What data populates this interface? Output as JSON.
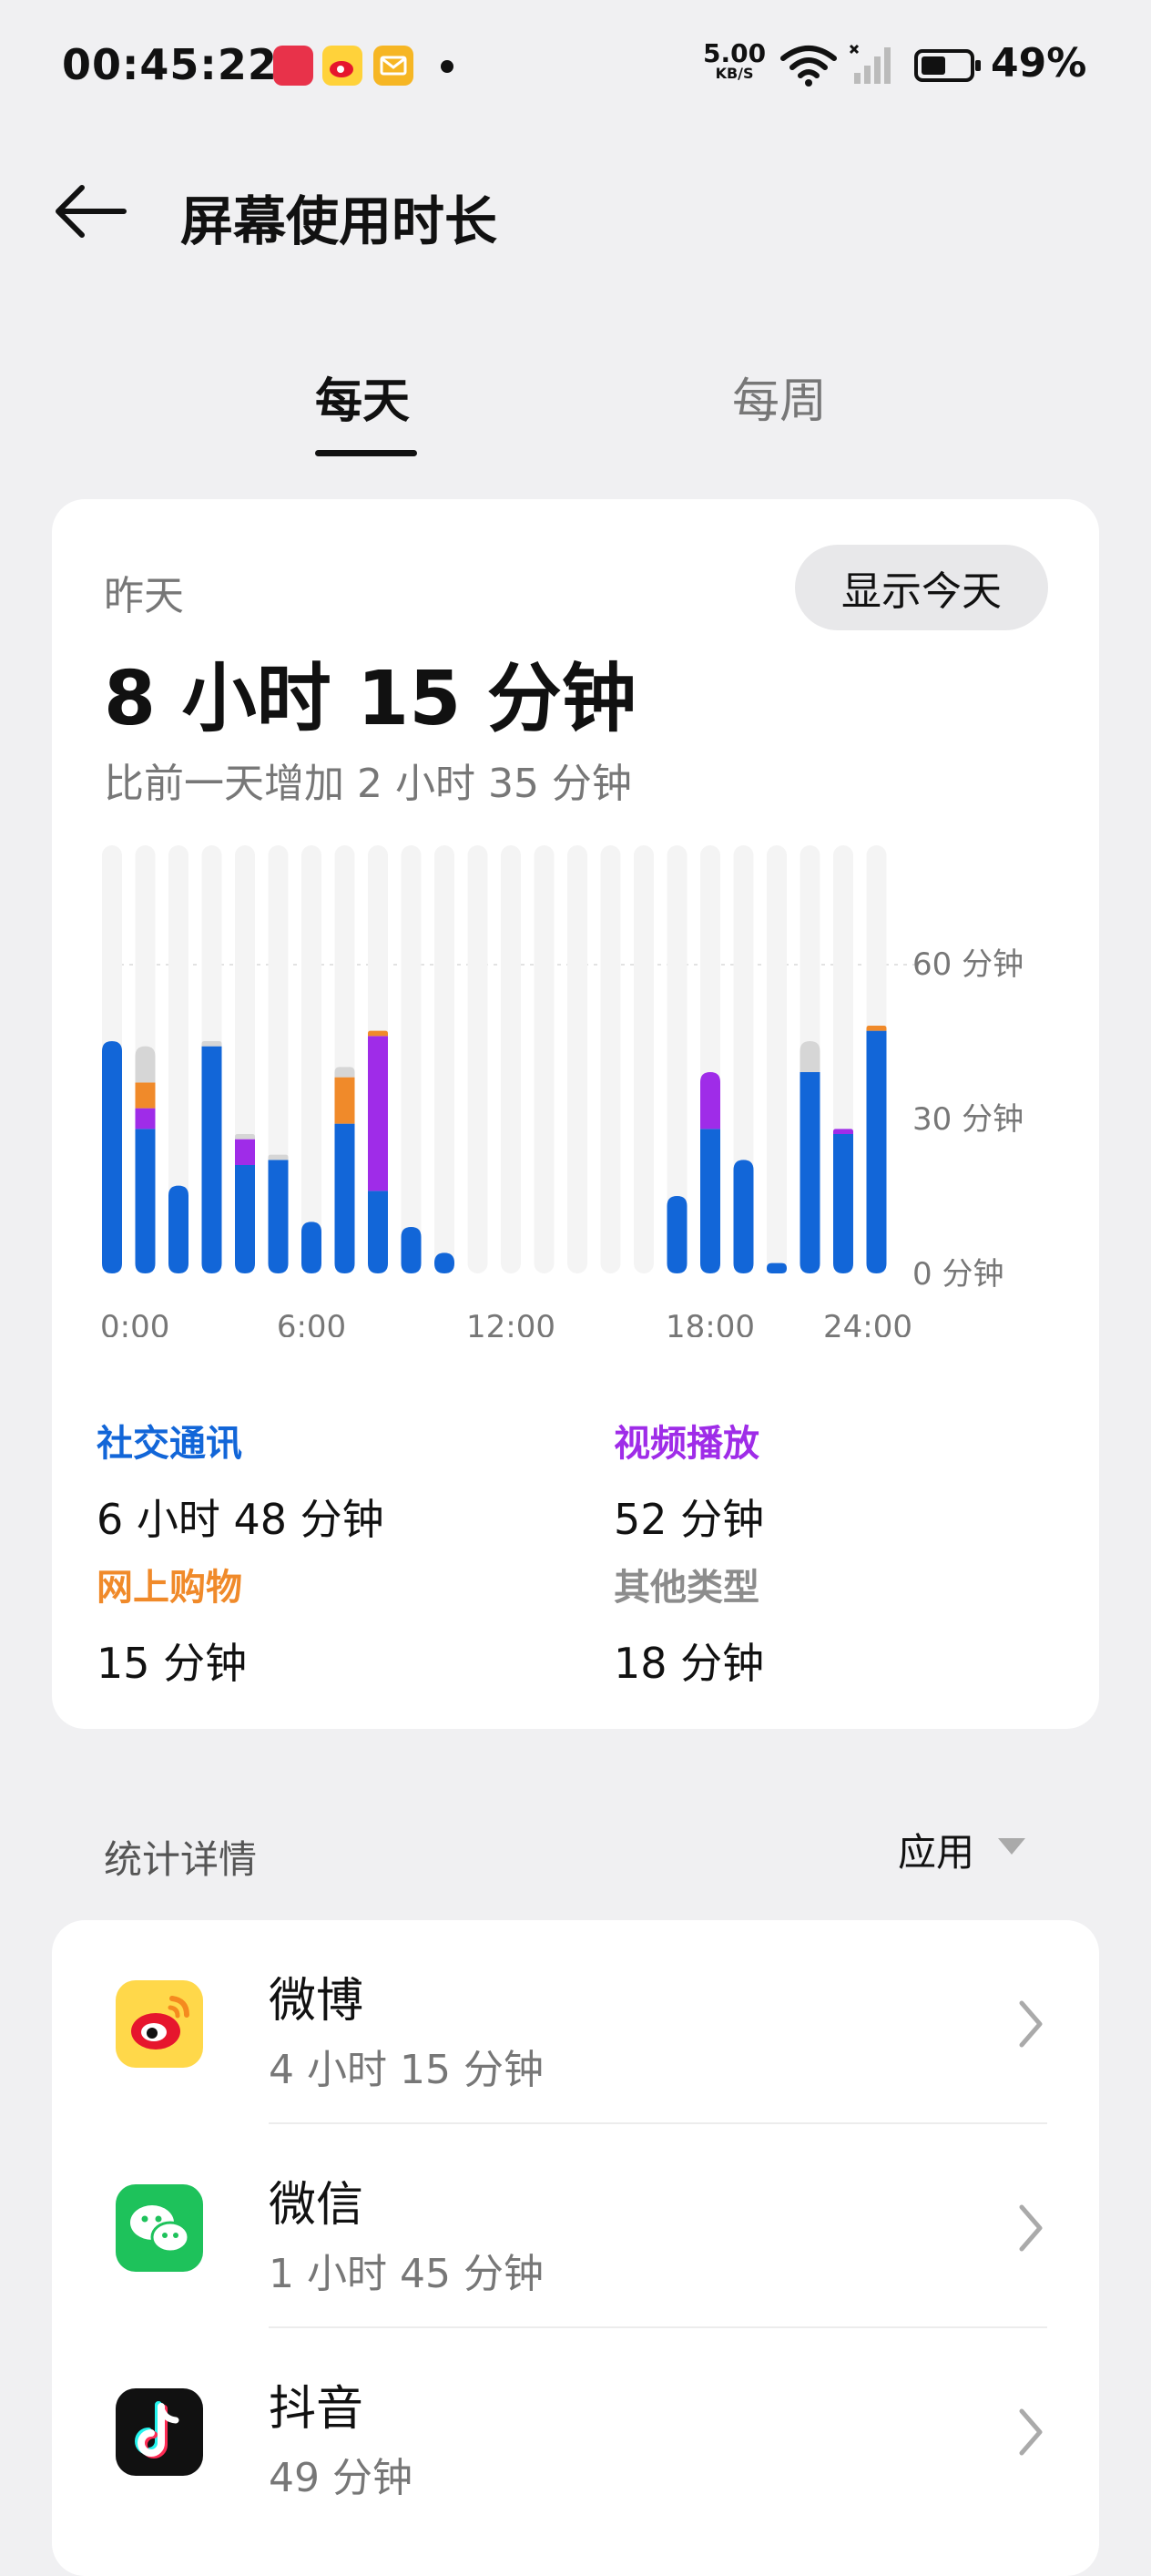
{
  "status_bar": {
    "time": "00:45:22",
    "net_speed": "5.00",
    "net_unit": "KB/S",
    "battery": "49%",
    "battery_level": 0.49
  },
  "header": {
    "title": "屏幕使用时长"
  },
  "tabs": [
    {
      "label": "每天",
      "active": true
    },
    {
      "label": "每周",
      "active": false
    }
  ],
  "summary": {
    "day_label": "昨天",
    "show_today_label": "显示今天",
    "total": "8 小时 15 分钟",
    "compare": "比前一天增加 2 小时 35 分钟"
  },
  "chart_data": {
    "type": "bar",
    "stacked": true,
    "x": [
      0,
      1,
      2,
      3,
      4,
      5,
      6,
      7,
      8,
      9,
      10,
      11,
      12,
      13,
      14,
      15,
      16,
      17,
      18,
      19,
      20,
      21,
      22,
      23,
      24
    ],
    "x_tick_labels": [
      "0:00",
      "6:00",
      "12:00",
      "18:00",
      "24:00"
    ],
    "y_tick_labels": [
      "60 分钟",
      "30 分钟",
      "0 分钟"
    ],
    "ylim": [
      0,
      60
    ],
    "colors": {
      "社交通讯": "#1266d8",
      "视频播放": "#9f2ce8",
      "网上购物": "#f08a2a",
      "其他类型": "#d6d6d6",
      "track": "#f4f4f4"
    },
    "series": [
      {
        "name": "社交通讯",
        "values": [
          45,
          28,
          17,
          44,
          21,
          22,
          10,
          29,
          16,
          9,
          4,
          0,
          0,
          0,
          0,
          0,
          0,
          15,
          28,
          22,
          2,
          39,
          27,
          47,
          0
        ]
      },
      {
        "name": "视频播放",
        "values": [
          0,
          4,
          0,
          0,
          5,
          0,
          0,
          0,
          30,
          0,
          0,
          0,
          0,
          0,
          0,
          0,
          0,
          0,
          11,
          0,
          0,
          0,
          1,
          0,
          0
        ]
      },
      {
        "name": "网上购物",
        "values": [
          0,
          5,
          0,
          0,
          0,
          0,
          0,
          9,
          1,
          0,
          0,
          0,
          0,
          0,
          0,
          0,
          0,
          0,
          0,
          0,
          0,
          0,
          0,
          1,
          0
        ]
      },
      {
        "name": "其他类型",
        "values": [
          0,
          7,
          0,
          1,
          1,
          1,
          0,
          2,
          0,
          0,
          0,
          0,
          0,
          0,
          0,
          0,
          0,
          0,
          0,
          0,
          0,
          6,
          0,
          0,
          0
        ]
      }
    ]
  },
  "categories": [
    {
      "name": "社交通讯",
      "value": "6 小时 48 分钟"
    },
    {
      "name": "视频播放",
      "value": "52 分钟"
    },
    {
      "name": "网上购物",
      "value": "15 分钟"
    },
    {
      "name": "其他类型",
      "value": "18 分钟"
    }
  ],
  "details": {
    "label": "统计详情",
    "filter": "应用"
  },
  "apps": [
    {
      "name": "微博",
      "time": "4 小时 15 分钟",
      "icon": "weibo-icon"
    },
    {
      "name": "微信",
      "time": "1 小时 45 分钟",
      "icon": "wechat-icon"
    },
    {
      "name": "抖音",
      "time": "49 分钟",
      "icon": "douyin-icon"
    }
  ]
}
